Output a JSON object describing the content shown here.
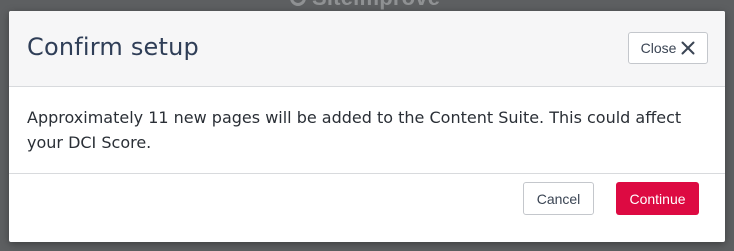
{
  "backdrop": {
    "logo_text": "Siteimprove",
    "logo_icon": "siteimprove-logo-icon"
  },
  "dialog": {
    "title": "Confirm setup",
    "close_label": "Close",
    "close_icon": "close-icon",
    "message": "Approximately 11 new pages will be added to the Content Suite. This could affect your DCI Score.",
    "cancel_label": "Cancel",
    "continue_label": "Continue"
  },
  "colors": {
    "overlay": "#5d5f61",
    "header_background": "#f6f6f7",
    "title_text": "#2f3e57",
    "primary_button": "#dd0a42",
    "primary_button_text": "#ffffff",
    "border": "#c4c7cc"
  }
}
